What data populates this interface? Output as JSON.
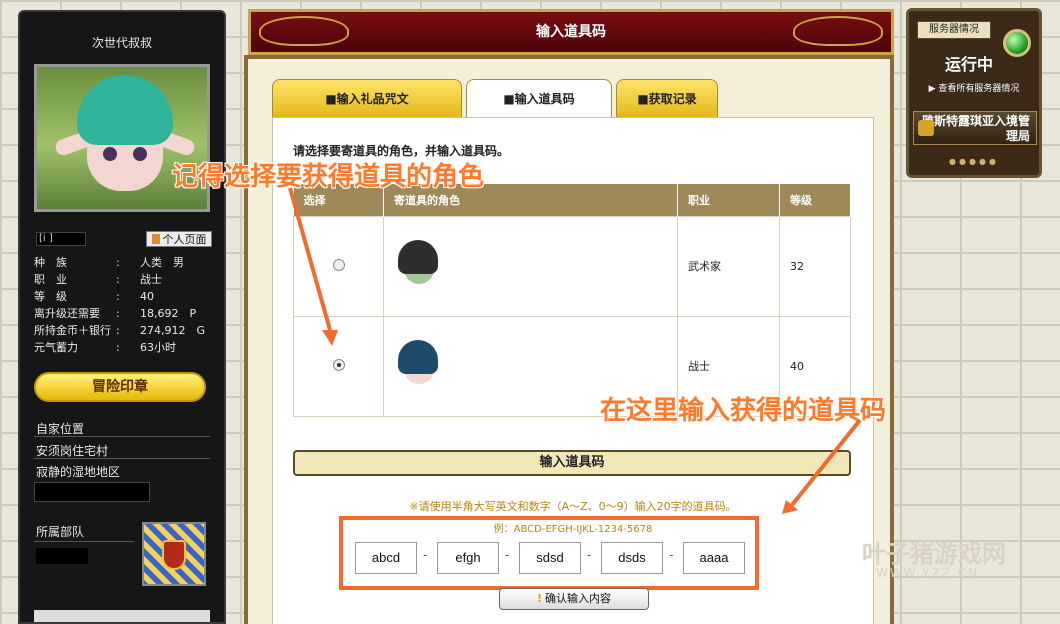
{
  "sidebar": {
    "char_name": "次世代叔叔",
    "id_label": "[i          ]",
    "profile_button": "个人页面",
    "stats": [
      {
        "k": "种　族",
        "v": "人类　男"
      },
      {
        "k": "职　业",
        "v": "战士"
      },
      {
        "k": "等　级",
        "v": "40"
      },
      {
        "k": "离升级还需要",
        "v": "18,692　P"
      },
      {
        "k": "所持金币＋银行",
        "v": "274,912　G"
      },
      {
        "k": "元气蓄力",
        "v": "63小时"
      }
    ],
    "adventure_button": "冒险印章",
    "location_label": "自家位置",
    "location_1": "安须岗住宅村",
    "location_2": "寂静的湿地地区",
    "team_label": "所属部队"
  },
  "header": {
    "title": "输入道具码"
  },
  "tabs": [
    {
      "label": "■输入礼品咒文"
    },
    {
      "label": "■输入道具码"
    },
    {
      "label": "■获取记录"
    }
  ],
  "content": {
    "instruction": "请选择要寄道具的角色，并输入道具码。",
    "table_headers": [
      "选择",
      "寄道具的角色",
      "职业",
      "等级"
    ],
    "rows": [
      {
        "job": "武术家",
        "level": "32",
        "selected": false
      },
      {
        "job": "战士",
        "level": "40",
        "selected": true
      }
    ],
    "code_header": "输入道具码",
    "code_note": "※请使用半角大写英文和数字（A～Z、0～9）输入20字的道具码。",
    "code_example": "例：ABCD-EFGH-IJKL-1234-5678",
    "code_values": [
      "abcd",
      "efgh",
      "sdsd",
      "dsds",
      "aaaa"
    ],
    "confirm_button": "确认输入内容"
  },
  "server": {
    "label": "服务器情况",
    "status": "运行中",
    "view_all": "▶ 查看所有服务器情况",
    "realm": "雅斯特露琪亚入境管理局"
  },
  "annotations": {
    "select_hint": "记得选择要获得道具的角色",
    "input_hint": "在这里输入获得的道具码"
  },
  "watermark": {
    "brand": "叶子猪游戏网",
    "url": "WWW.YZZ.CN"
  },
  "colors": {
    "accent": "#f06b2e",
    "header": "#6a0a0e",
    "tab": "#f0c93a"
  }
}
